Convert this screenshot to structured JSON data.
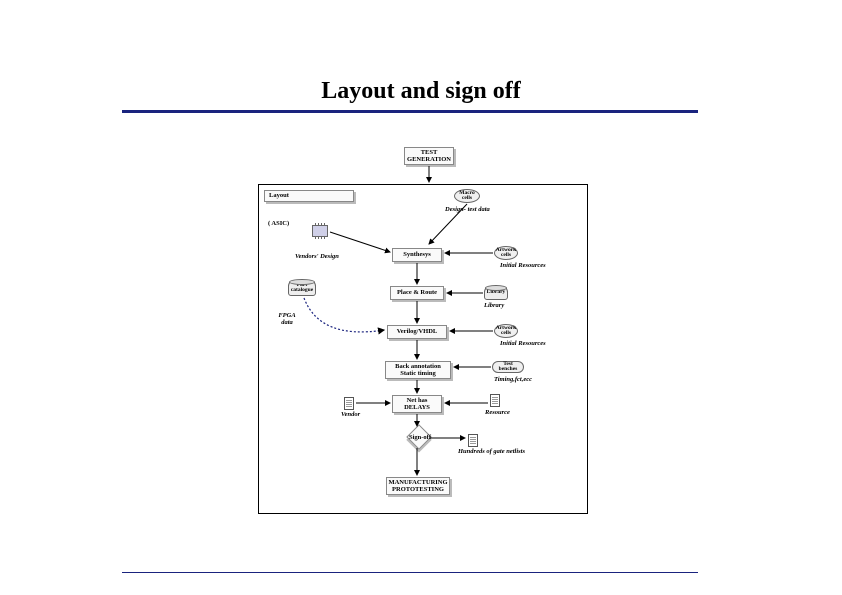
{
  "title": "Layout and sign off",
  "boxes": {
    "test_gen": "TEST\nGENERATION",
    "layout": "Layout",
    "asic": "( ASIC)",
    "synthesys1": "Synthesys",
    "place_route": "Place & Route",
    "verilog_vhdl": "Verilog/VHDL",
    "back_annotation": "Back annotation\nStatic timing",
    "net_has_delays": "Net has\nDELAYS",
    "manufacturing": "MANUFACTURING\nPROTOTESTING"
  },
  "bubbles": {
    "macro_cells": "Macro\ncells",
    "artwork_cells1": "Artwork\ncells",
    "artwork_cells2": "Artwork\ncells",
    "test_benches": "Test benches"
  },
  "labels": {
    "design_test_data": "Design- test data",
    "vendors_design": "Vendors' Design",
    "initial_resources1": "Initial\nResources",
    "initial_resources2": "Initial\nResources",
    "timing_fct_ecc": "Timing,fct,ecc",
    "vendor": "Vendor",
    "resource": "Resource",
    "hundreds": "Hundreds of gate netlists",
    "library": "Library",
    "sign_off": "Sign-off"
  },
  "cylinders": {
    "part_catalogue": "Part\ncatalogue",
    "library": "Library",
    "fpga_data": "FPGA\n data"
  }
}
